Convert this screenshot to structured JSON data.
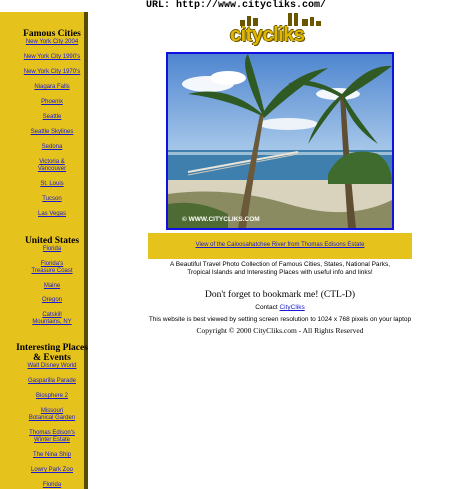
{
  "url_bar": {
    "label": "URL:",
    "url": "http://www.citycliks.com/"
  },
  "logo": {
    "text": "citycliks"
  },
  "sidebar": {
    "famous_cities": {
      "title": "Famous Cities",
      "links": [
        "New York City 2004",
        "New York City 1990's",
        "New York City 1970's",
        "Niagara Falls",
        "Phoenix",
        "Seattle",
        "Seattle Skylines",
        "Sedona",
        "Victoria &",
        "Vancouver",
        "St. Louis",
        "Tucson",
        "Las Vegas"
      ]
    },
    "united_states": {
      "title": "United States",
      "links": [
        "Florida",
        "Florida's",
        "Treasure Coast",
        "Maine",
        "Oregon",
        "Catskill",
        "Mountains, NY"
      ]
    },
    "interesting": {
      "title_line1": "Interesting Places",
      "title_line2": "& Events",
      "links": [
        "Walt Disney World",
        "Gasparilla Parade",
        "Biosphere 2",
        "Missouri",
        "Botanical Garden",
        "Thomas Edison's",
        "Winter Estate",
        "The Nina Ship",
        "Lowry Park Zoo",
        "Florida"
      ]
    }
  },
  "main": {
    "photo_watermark": "© WWW.CITYCLIKS.COM",
    "caption_link": "View of the Caloosahatchee River from Thomas Edisons Estate",
    "description_line1": "A Beautiful Travel Photo Collection of Famous Cities, States, National Parks,",
    "description_line2": "Tropical Islands and Interesting Places with useful info and links!",
    "bookmark": "Don't forget to bookmark me! (CTL-D)",
    "contact_label": "Contact",
    "contact_link": "CityCliks",
    "resolution_note": "This website is best viewed by setting screen resolution to 1024 x 768 pixels on your laptop",
    "copyright": "Copyright © 2000 CityCliks.com - All Rights Reserved"
  },
  "colors": {
    "sidebar": "#e6c21c",
    "link": "#1a1ad0",
    "photo_border": "#1010e0"
  }
}
